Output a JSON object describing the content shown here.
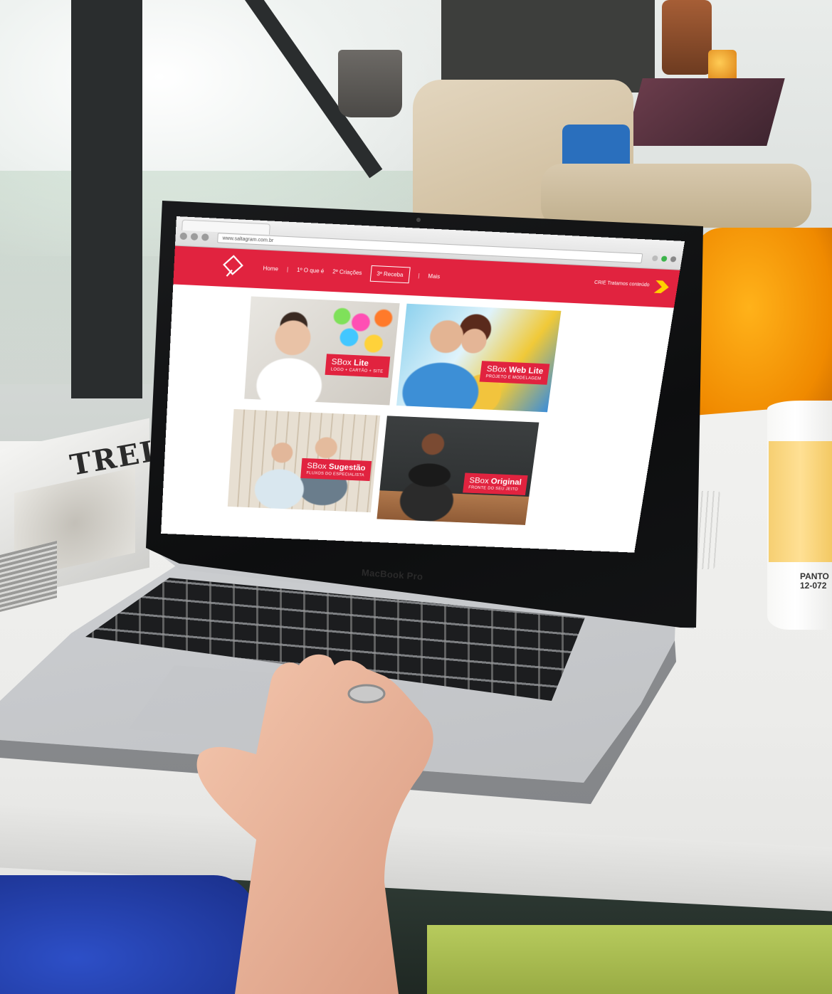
{
  "browser": {
    "address": "www.saltagram.com.br"
  },
  "site": {
    "brand_color": "#e1233f",
    "logo_icon": "diamond-logo-icon",
    "menu": [
      {
        "label": "Home"
      },
      {
        "label": "1º O que é"
      },
      {
        "label": "2º Criações"
      },
      {
        "label": "3º Receba"
      },
      {
        "label": "Mais"
      }
    ],
    "separators": [
      "|",
      "|",
      "|"
    ],
    "cta_label": "CRIE Tratamos conteúdo"
  },
  "products": [
    {
      "name_prefix": "SBox ",
      "name_bold": "Lite",
      "subtitle": "LOGO + CARTÃO + SITE"
    },
    {
      "name_prefix": "SBox ",
      "name_bold": "Web Lite",
      "subtitle": "PROJETO E MODELAGEM"
    },
    {
      "name_prefix": "SBox ",
      "name_bold": "Sugestão",
      "subtitle": "FLUXOS DO ESPECIALISTA"
    },
    {
      "name_prefix": "SBox ",
      "name_bold": "Original",
      "subtitle": "FRONTE DO SEU JEITO"
    }
  ],
  "scene": {
    "magazine_text": "TREL",
    "laptop_label": "MacBook Pro",
    "mug_text": [
      "PANTO",
      "12-072"
    ]
  }
}
